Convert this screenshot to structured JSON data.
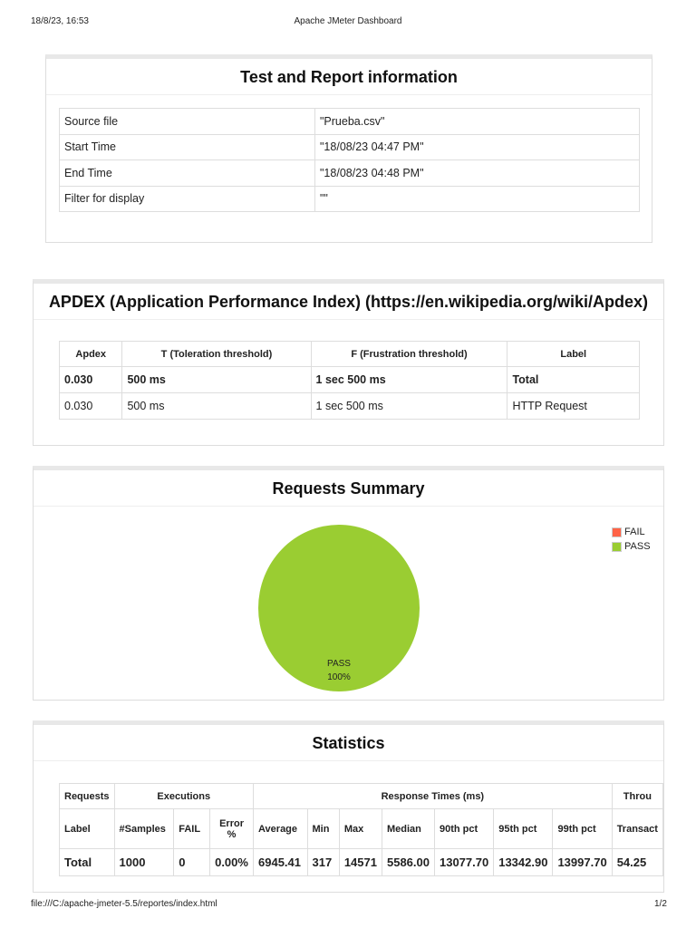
{
  "header": {
    "datetime": "18/8/23, 16:53",
    "title": "Apache JMeter Dashboard"
  },
  "footer": {
    "url": "file:///C:/apache-jmeter-5.5/reportes/index.html",
    "page": "1/2"
  },
  "info": {
    "title": "Test and Report information",
    "rows": [
      [
        "Source file",
        "\"Prueba.csv\""
      ],
      [
        "Start Time",
        "\"18/08/23 04:47 PM\""
      ],
      [
        "End Time",
        "\"18/08/23 04:48 PM\""
      ],
      [
        "Filter for display",
        "\"\""
      ]
    ]
  },
  "apdex": {
    "title": "APDEX (Application Performance Index) (https://en.wikipedia.org/wiki/Apdex)",
    "headers": [
      "Apdex",
      "T (Toleration threshold)",
      "F (Frustration threshold)",
      "Label"
    ],
    "rows": [
      [
        "0.030",
        "500 ms",
        "1 sec 500 ms",
        "Total"
      ],
      [
        "0.030",
        "500 ms",
        "1 sec 500 ms",
        "HTTP Request"
      ]
    ]
  },
  "summary": {
    "title": "Requests Summary",
    "legend": [
      {
        "label": "FAIL",
        "color": "#ff6347"
      },
      {
        "label": "PASS",
        "color": "#9acd32"
      }
    ],
    "slice_label": "PASS",
    "slice_pct": "100%"
  },
  "chart_data": {
    "type": "pie",
    "title": "Requests Summary",
    "categories": [
      "FAIL",
      "PASS"
    ],
    "values": [
      0,
      100
    ],
    "legend": "top-right"
  },
  "stats": {
    "title": "Statistics",
    "groups": [
      "Requests",
      "Executions",
      "Response Times (ms)",
      "Throu"
    ],
    "headers": [
      "Label",
      "#Samples",
      "FAIL",
      "Error %",
      "Average",
      "Min",
      "Max",
      "Median",
      "90th pct",
      "95th pct",
      "99th pct",
      "Transact"
    ],
    "row": [
      "Total",
      "1000",
      "0",
      "0.00%",
      "6945.41",
      "317",
      "14571",
      "5586.00",
      "13077.70",
      "13342.90",
      "13997.70",
      "54.25"
    ]
  }
}
